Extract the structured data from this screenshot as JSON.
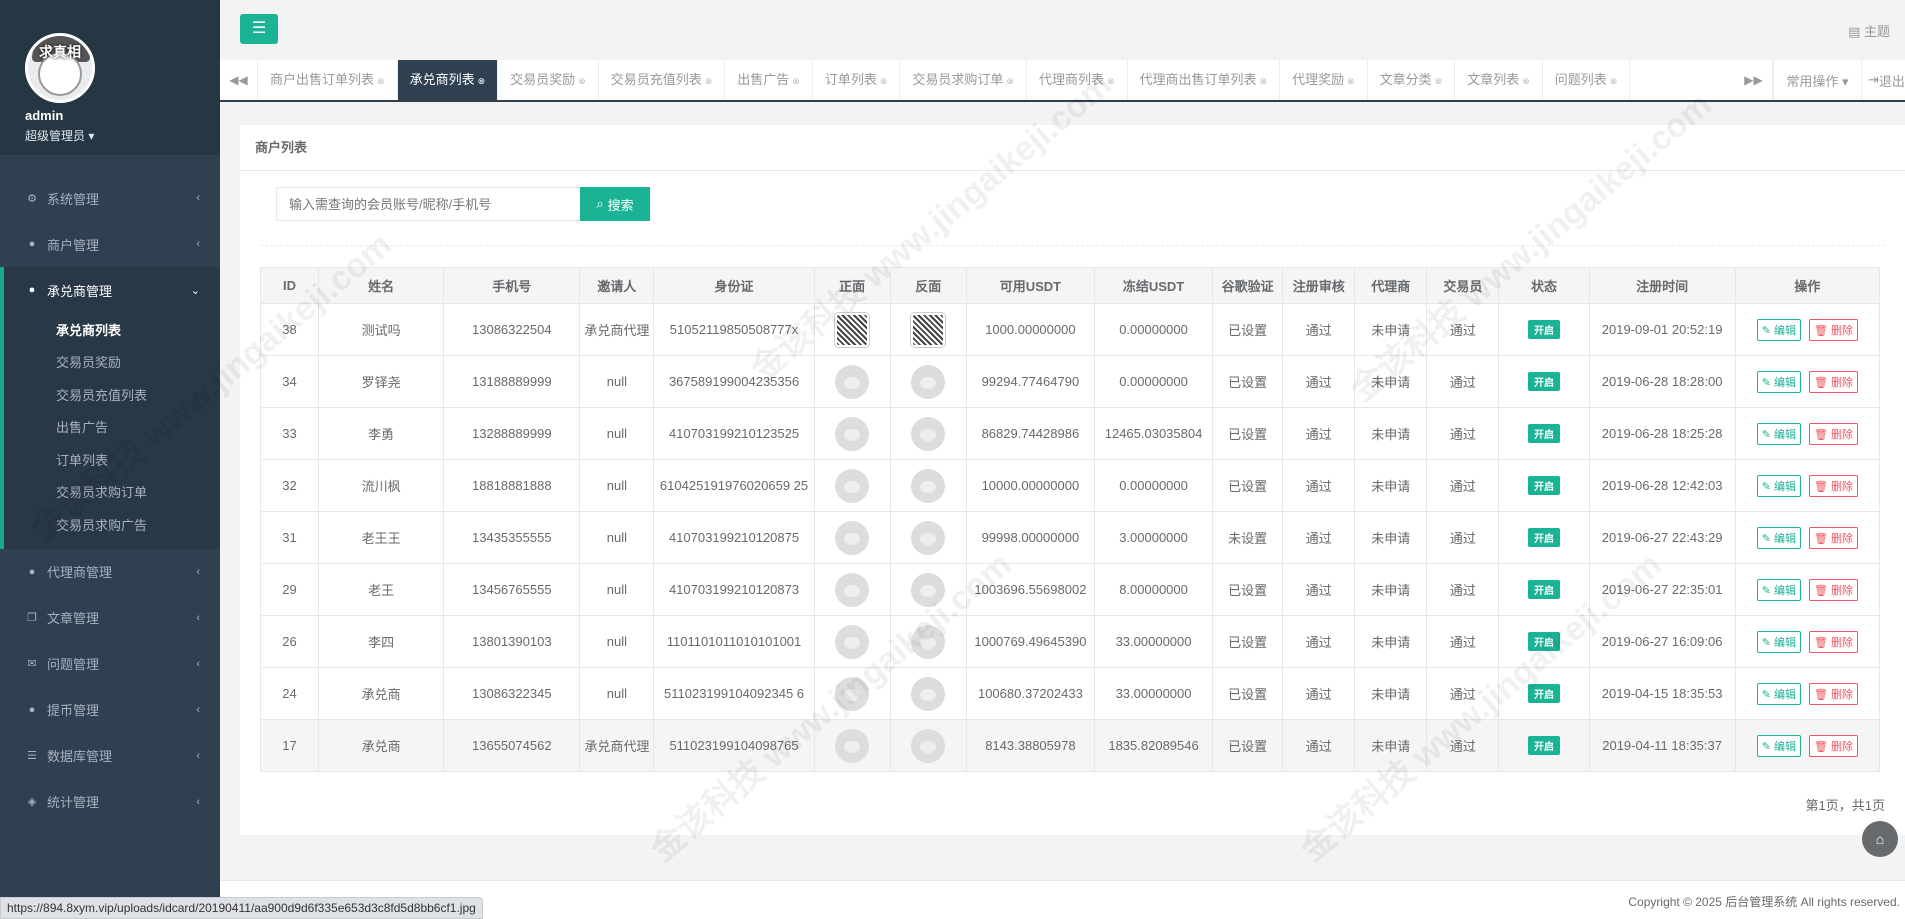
{
  "sidebar": {
    "avatar_caption": "求真相",
    "username": "admin",
    "role": "超级管理员 ▾",
    "menu": [
      {
        "label": "系统管理"
      },
      {
        "label": "商户管理"
      },
      {
        "label": "承兑商管理"
      },
      {
        "label": "代理商管理"
      },
      {
        "label": "文章管理"
      },
      {
        "label": "问题管理"
      },
      {
        "label": "提币管理"
      },
      {
        "label": "数据库管理"
      },
      {
        "label": "统计管理"
      }
    ],
    "submenu": [
      "承兑商列表",
      "交易员奖励",
      "交易员充值列表",
      "出售广告",
      "订单列表",
      "交易员求购订单",
      "交易员求购广告"
    ]
  },
  "topbar": {
    "theme_label": "主题"
  },
  "tabs": [
    "商户出售订单列表",
    "承兑商列表",
    "交易员奖励",
    "交易员充值列表",
    "出售广告",
    "订单列表",
    "交易员求购订单",
    "代理商列表",
    "代理商出售订单列表",
    "代理奖励",
    "文章分类",
    "文章列表",
    "问题列表"
  ],
  "tabbar": {
    "ops_label": "常用操作 ▾",
    "logout_label": "退出"
  },
  "panel": {
    "title": "商户列表",
    "search_placeholder": "输入需查询的会员账号/昵称/手机号",
    "search_button": "搜索",
    "pageinfo": "第1页，共1页"
  },
  "table": {
    "headers": [
      "ID",
      "姓名",
      "手机号",
      "邀请人",
      "身份证",
      "正面",
      "反面",
      "可用USDT",
      "冻结USDT",
      "谷歌验证",
      "注册审核",
      "代理商",
      "交易员",
      "状态",
      "注册时间",
      "操作"
    ],
    "rows": [
      [
        "38",
        "测试吗",
        "13086322504",
        "承兑商代理",
        "51052119850508777x",
        "",
        "",
        "1000.00000000",
        "0.00000000",
        "已设置",
        "通过",
        "未申请",
        "通过",
        "开启",
        "2019-09-01 20:52:19"
      ],
      [
        "34",
        "罗铎尧",
        "13188889999",
        "null",
        "367589199004235356",
        "",
        "",
        "99294.77464790",
        "0.00000000",
        "已设置",
        "通过",
        "未申请",
        "通过",
        "开启",
        "2019-06-28 18:28:00"
      ],
      [
        "33",
        "李勇",
        "13288889999",
        "null",
        "410703199210123525",
        "",
        "",
        "86829.74428986",
        "12465.03035804",
        "已设置",
        "通过",
        "未申请",
        "通过",
        "开启",
        "2019-06-28 18:25:28"
      ],
      [
        "32",
        "流川枫",
        "18818881888",
        "null",
        "610425191976020659 25",
        "",
        "",
        "10000.00000000",
        "0.00000000",
        "已设置",
        "通过",
        "未申请",
        "通过",
        "开启",
        "2019-06-28 12:42:03"
      ],
      [
        "31",
        "老王王",
        "13435355555",
        "null",
        "410703199210120875",
        "",
        "",
        "99998.00000000",
        "3.00000000",
        "未设置",
        "通过",
        "未申请",
        "通过",
        "开启",
        "2019-06-27 22:43:29"
      ],
      [
        "29",
        "老王",
        "13456765555",
        "null",
        "410703199210120873",
        "",
        "",
        "1003696.55698002",
        "8.00000000",
        "已设置",
        "通过",
        "未申请",
        "通过",
        "开启",
        "2019-06-27 22:35:01"
      ],
      [
        "26",
        "李四",
        "13801390103",
        "null",
        "1101101011010101001",
        "",
        "",
        "1000769.49645390",
        "33.00000000",
        "已设置",
        "通过",
        "未申请",
        "通过",
        "开启",
        "2019-06-27 16:09:06"
      ],
      [
        "24",
        "承兑商",
        "13086322345",
        "null",
        "511023199104092345 6",
        "",
        "",
        "100680.37202433",
        "33.00000000",
        "已设置",
        "通过",
        "未申请",
        "通过",
        "开启",
        "2019-04-15 18:35:53"
      ],
      [
        "17",
        "承兑商",
        "13655074562",
        "承兑商代理",
        "511023199104098765",
        "",
        "",
        "8143.38805978",
        "1835.82089546",
        "已设置",
        "通过",
        "未申请",
        "通过",
        "开启",
        "2019-04-11 18:35:37"
      ]
    ],
    "edit_label": "编辑",
    "delete_label": "删除"
  },
  "footer": {
    "copyright": "Copyright © 2025 后台管理系统 All rights reserved."
  },
  "statusbar": {
    "url": "https://894.8xym.vip/uploads/idcard/20190411/aa900d9d6f335e653d3c8fd5d8bb6cf1.jpg"
  },
  "watermark": "金该科技 www.jingaikeji.com",
  "colors": {
    "accent": "#1ab394",
    "sidebar": "#2f4050",
    "danger": "#ed5565"
  }
}
